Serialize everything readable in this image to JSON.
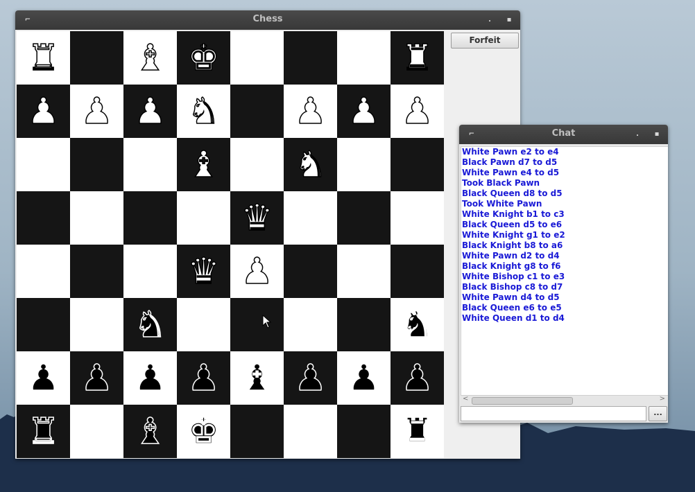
{
  "chess_window": {
    "title": "Chess",
    "forfeit_label": "Forfeit",
    "board": [
      [
        "wR",
        "",
        "wB",
        "wK",
        "",
        "",
        "",
        "wR"
      ],
      [
        "wP",
        "wP",
        "wP",
        "wN",
        "",
        "wP",
        "wP",
        "wP"
      ],
      [
        "",
        "",
        "",
        "wB",
        "",
        "wN",
        "",
        ""
      ],
      [
        "",
        "",
        "",
        "",
        "wQ",
        "",
        "",
        ""
      ],
      [
        "",
        "",
        "",
        "wQ",
        "wP",
        "",
        "",
        ""
      ],
      [
        "",
        "",
        "bN",
        "",
        "",
        "",
        "",
        "bN"
      ],
      [
        "bP",
        "bP",
        "bP",
        "bP",
        "bB",
        "bP",
        "bP",
        "bP"
      ],
      [
        "bR",
        "",
        "bB",
        "bK",
        "",
        "",
        "",
        "bR"
      ]
    ],
    "colors": {
      "light_square": "#ffffff",
      "dark_square": "#151515"
    }
  },
  "chat_window": {
    "title": "Chat",
    "messages": [
      "White Pawn e2 to e4",
      "Black Pawn d7 to d5",
      "White Pawn e4 to d5",
      "Took Black Pawn",
      "Black Queen d8 to d5",
      "Took White Pawn",
      "White Knight b1 to c3",
      "Black Queen d5 to e6",
      "White Knight g1 to e2",
      "Black Knight b8 to a6",
      "White Pawn d2 to d4",
      "Black Knight g8 to f6",
      "White Bishop c1 to e3",
      "Black Bishop c8 to d7",
      "White Pawn d4 to d5",
      "Black Queen e6 to e5",
      "White Queen d1 to d4"
    ],
    "input_value": "",
    "send_label": "...",
    "message_color": "#1a1ad6"
  }
}
